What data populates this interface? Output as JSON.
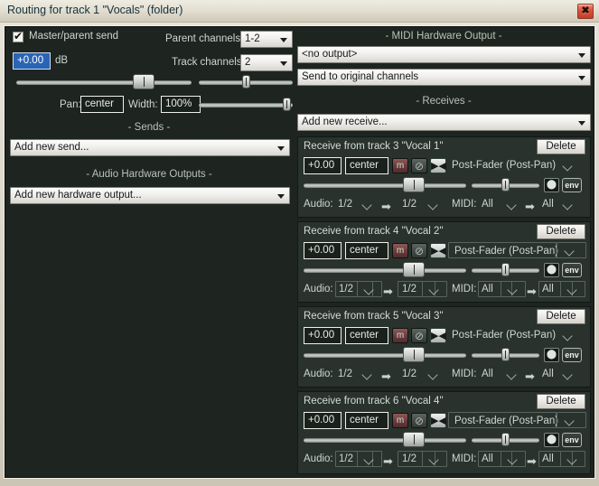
{
  "window": {
    "title": "Routing for track 1 \"Vocals\" (folder)",
    "close_label": "✖",
    "close_icon": "close-icon"
  },
  "left": {
    "master_send": {
      "label": "Master/parent send",
      "checked": true
    },
    "parent_channels": {
      "label": "Parent channels:",
      "value": "1-2"
    },
    "track_channels": {
      "label": "Track channels:",
      "value": "2"
    },
    "volume": {
      "value": "+0.00",
      "unit": "dB"
    },
    "pan": {
      "label": "Pan:",
      "value": "center"
    },
    "width": {
      "label": "Width:",
      "value": "100%"
    },
    "sends": {
      "title": "-  Sends  -",
      "add_label": "Add new send..."
    },
    "hardware": {
      "title": "-  Audio Hardware Outputs  -",
      "add_label": "Add new hardware output..."
    }
  },
  "right": {
    "midi_hw": {
      "title": "-  MIDI Hardware Output  -",
      "output": "<no output>",
      "channels": "Send to original channels"
    },
    "receives": {
      "title": "-  Receives  -",
      "add_label": "Add new receive..."
    },
    "blocks": [
      {
        "header": "Receive from track 3 \"Vocal 1\"",
        "delete_label": "Delete",
        "volume": "+0.00",
        "pan": "center",
        "mute_label": "m",
        "phase_label": "⊘",
        "stereo_label": "▶◀",
        "mode": "Post-Fader (Post-Pan)",
        "audio_label": "Audio:",
        "audio_src": "1/2",
        "audio_dst": "1/2",
        "midi_label": "MIDI:",
        "midi_src": "All",
        "midi_dst": "All",
        "env_label": "env",
        "midi_icon_label": "⬤",
        "framed": false
      },
      {
        "header": "Receive from track 4 \"Vocal 2\"",
        "delete_label": "Delete",
        "volume": "+0.00",
        "pan": "center",
        "mute_label": "m",
        "phase_label": "⊘",
        "stereo_label": "▶◀",
        "mode": "Post-Fader (Post-Pan)",
        "audio_label": "Audio:",
        "audio_src": "1/2",
        "audio_dst": "1/2",
        "midi_label": "MIDI:",
        "midi_src": "All",
        "midi_dst": "All",
        "env_label": "env",
        "midi_icon_label": "⬤",
        "framed": true
      },
      {
        "header": "Receive from track 5 \"Vocal 3\"",
        "delete_label": "Delete",
        "volume": "+0.00",
        "pan": "center",
        "mute_label": "m",
        "phase_label": "⊘",
        "stereo_label": "▶◀",
        "mode": "Post-Fader (Post-Pan)",
        "audio_label": "Audio:",
        "audio_src": "1/2",
        "audio_dst": "1/2",
        "midi_label": "MIDI:",
        "midi_src": "All",
        "midi_dst": "All",
        "env_label": "env",
        "midi_icon_label": "⬤",
        "framed": false
      },
      {
        "header": "Receive from track 6 \"Vocal 4\"",
        "delete_label": "Delete",
        "volume": "+0.00",
        "pan": "center",
        "mute_label": "m",
        "phase_label": "⊘",
        "stereo_label": "▶◀",
        "mode": "Post-Fader (Post-Pan)",
        "audio_label": "Audio:",
        "audio_src": "1/2",
        "audio_dst": "1/2",
        "midi_label": "MIDI:",
        "midi_src": "All",
        "midi_dst": "All",
        "env_label": "env",
        "midi_icon_label": "⬤",
        "framed": true
      }
    ]
  },
  "colors": {
    "panel_bg": "#1e2420",
    "block_bg": "#29332d",
    "title_text": "#18303c",
    "accent_select": "#2a64b4",
    "mute_red": "#6d3d3c"
  }
}
